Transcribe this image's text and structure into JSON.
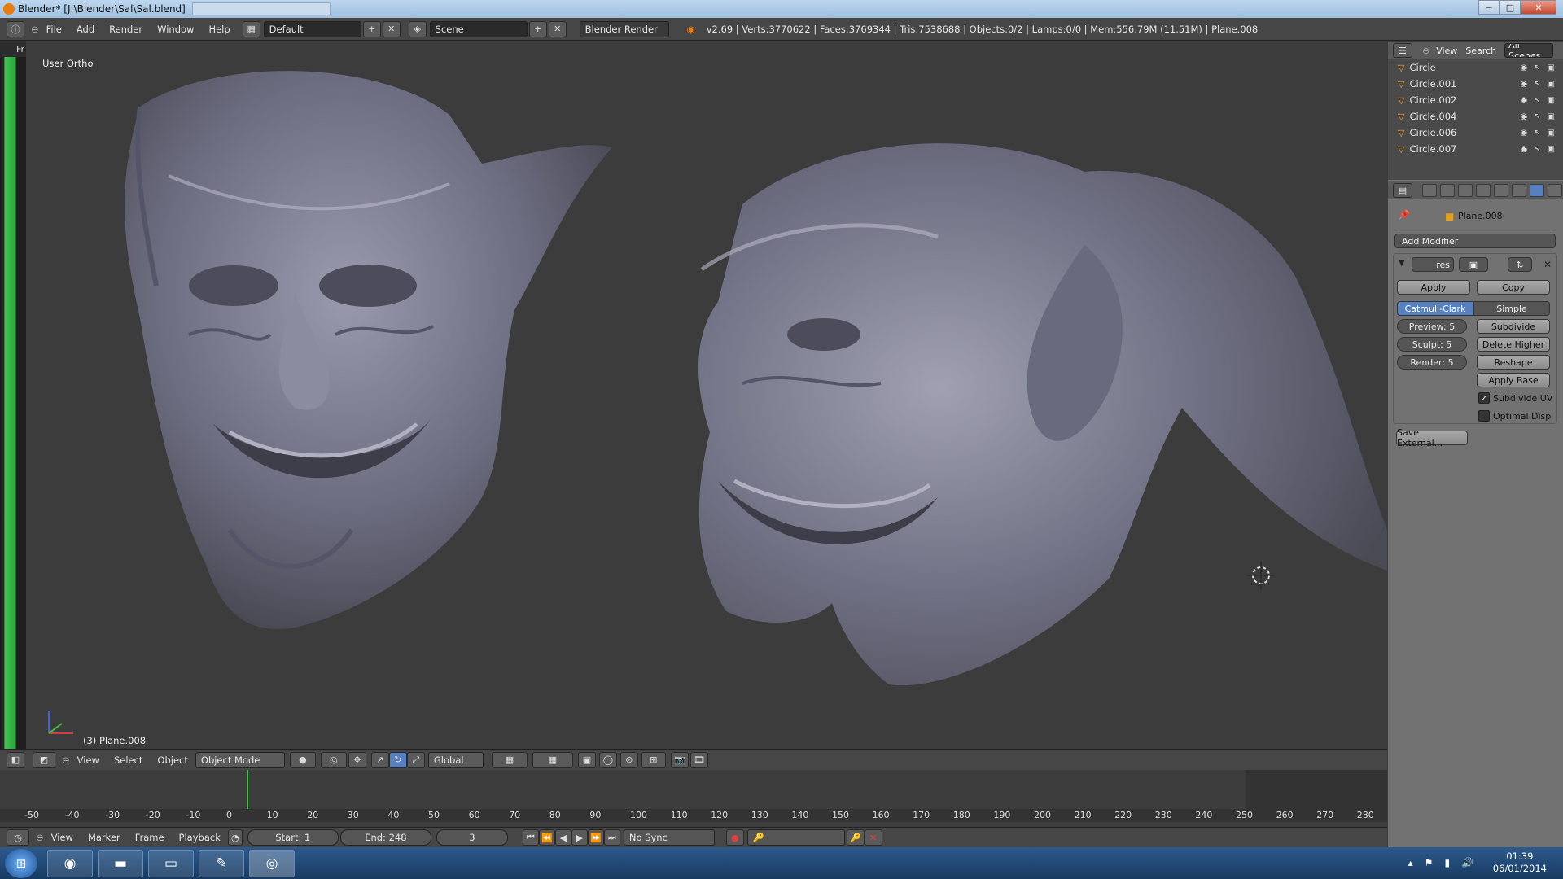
{
  "window": {
    "title": "Blender* [J:\\Blender\\Sal\\Sal.blend]"
  },
  "menu": {
    "file": "File",
    "add": "Add",
    "render": "Render",
    "window": "Window",
    "help": "Help"
  },
  "layout": "Default",
  "scene": "Scene",
  "engine": "Blender Render",
  "stats": "v2.69 | Verts:3770622 | Faces:3769344 | Tris:7538688 | Objects:0/2 | Lamps:0/0 | Mem:556.79M (11.51M) | Plane.008",
  "viewport": {
    "view_label": "User Ortho",
    "active_object": "(3) Plane.008",
    "side_frag": "Fr"
  },
  "outliner": {
    "view": "View",
    "search": "Search",
    "scenes": "All Scenes",
    "items": [
      "Circle",
      "Circle.001",
      "Circle.002",
      "Circle.004",
      "Circle.006",
      "Circle.007"
    ]
  },
  "properties": {
    "object": "Plane.008",
    "add_modifier": "Add Modifier",
    "mod_name": "res",
    "apply": "Apply",
    "copy": "Copy",
    "catmull": "Catmull-Clark",
    "simple": "Simple",
    "preview": "Preview: 5",
    "sculpt": "Sculpt: 5",
    "render": "Render: 5",
    "subdivide": "Subdivide",
    "delete_higher": "Delete Higher",
    "reshape": "Reshape",
    "apply_base": "Apply Base",
    "subdivide_uv": "Subdivide UV",
    "subdivide_uv_checked": true,
    "optimal_disp": "Optimal Disp",
    "optimal_disp_checked": false,
    "save_external": "Save External..."
  },
  "view3d_header": {
    "view": "View",
    "select": "Select",
    "object": "Object",
    "mode": "Object Mode",
    "orientation": "Global"
  },
  "timeline": {
    "ticks": [
      "-50",
      "-40",
      "-30",
      "-20",
      "-10",
      "0",
      "10",
      "20",
      "30",
      "40",
      "50",
      "60",
      "70",
      "80",
      "90",
      "100",
      "110",
      "120",
      "130",
      "140",
      "150",
      "160",
      "170",
      "180",
      "190",
      "200",
      "210",
      "220",
      "230",
      "240",
      "250",
      "260",
      "270",
      "280"
    ],
    "current_frame": 3
  },
  "timeline_header": {
    "view": "View",
    "marker": "Marker",
    "frame": "Frame",
    "playback": "Playback",
    "start": "Start: 1",
    "end": "End: 248",
    "current": "3",
    "sync": "No Sync"
  },
  "taskbar": {
    "time": "01:39",
    "date": "06/01/2014"
  }
}
